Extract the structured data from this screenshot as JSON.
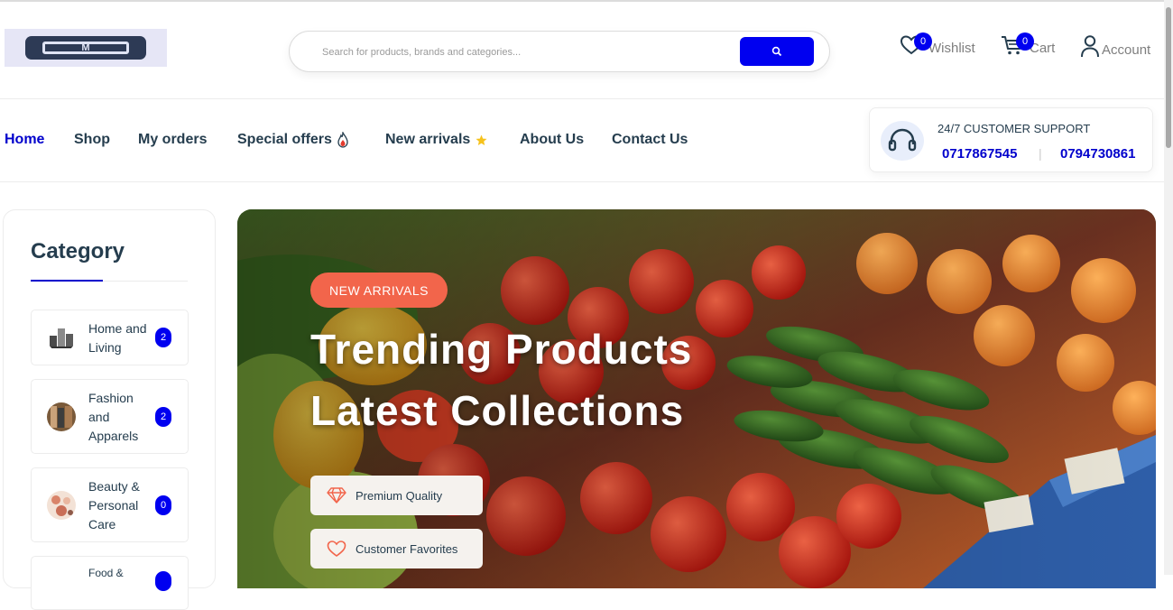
{
  "header": {
    "logo_alt": "M",
    "search": {
      "placeholder": "Search for products, brands and categories..."
    },
    "wishlist": {
      "label": "Wishlist",
      "count": "0",
      "icon": "heart-icon"
    },
    "cart": {
      "label": "Cart",
      "count": "0",
      "icon": "cart-icon"
    },
    "account": {
      "label": "Account",
      "icon": "user-icon"
    }
  },
  "nav": {
    "items": [
      {
        "label": "Home",
        "active": true
      },
      {
        "label": "Shop"
      },
      {
        "label": "My orders"
      },
      {
        "label": "Special offers",
        "icon": "flame-icon"
      },
      {
        "label": "New arrivals",
        "icon": "star-icon"
      },
      {
        "label": "About Us"
      },
      {
        "label": "Contact Us"
      }
    ]
  },
  "support": {
    "title": "24/7 CUSTOMER SUPPORT",
    "phone1": "0717867545",
    "phone2": "0794730861",
    "separator": "|",
    "icon": "headset-icon"
  },
  "sidebar": {
    "title": "Category",
    "categories": [
      {
        "name": "Home and Living",
        "count": "2"
      },
      {
        "name": "Fashion and Apparels",
        "count": "2"
      },
      {
        "name": "Beauty & Personal Care",
        "count": "0"
      },
      {
        "name": "Food &",
        "count": ""
      }
    ]
  },
  "hero": {
    "tag": "NEW ARRIVALS",
    "line1": "Trending Products",
    "line2": "Latest Collections",
    "feature1": "Premium Quality",
    "feature2": "Customer Favorites"
  },
  "colors": {
    "accent": "#0000f0",
    "tag": "#f2654b",
    "text": "#253d4e"
  }
}
